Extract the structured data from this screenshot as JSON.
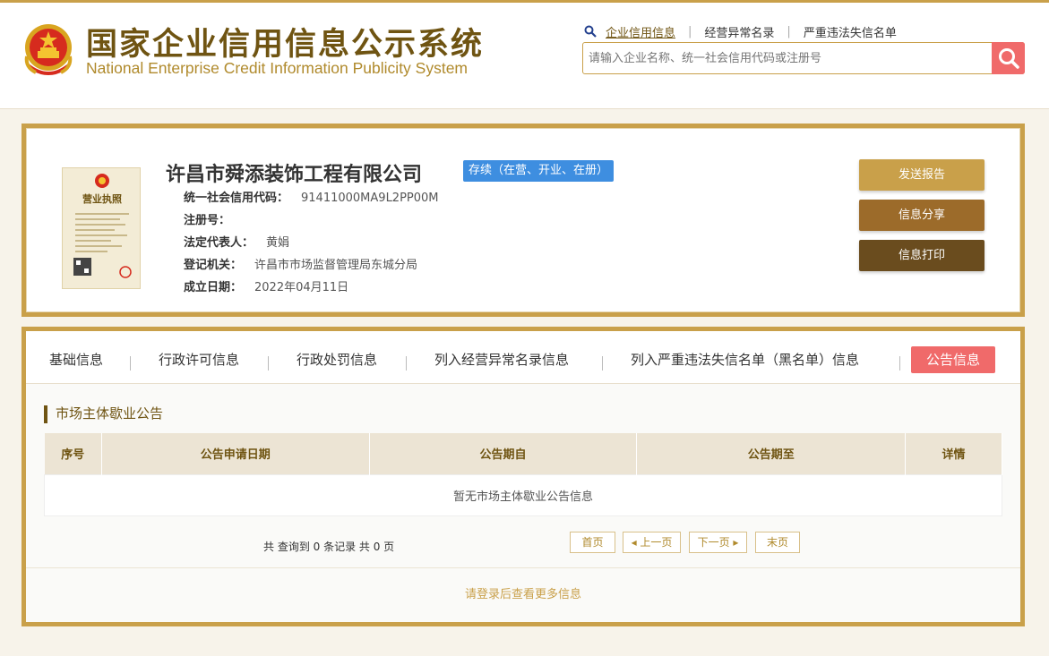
{
  "header": {
    "title_cn": "国家企业信用信息公示系统",
    "title_en": "National Enterprise Credit Information Publicity System",
    "nav": [
      "企业信用信息",
      "经营异常名录",
      "严重违法失信名单"
    ],
    "search_placeholder": "请输入企业名称、统一社会信用代码或注册号"
  },
  "company": {
    "name": "许昌市舜添装饰工程有限公司",
    "status": "存续（在营、开业、在册）",
    "fields": [
      {
        "label": "统一社会信用代码：",
        "value": "91411000MA9L2PP00M"
      },
      {
        "label": "注册号：",
        "value": ""
      },
      {
        "label": "法定代表人：",
        "value": "黄娟"
      },
      {
        "label": "登记机关：",
        "value": "许昌市市场监督管理局东城分局"
      },
      {
        "label": "成立日期：",
        "value": "2022年04月11日"
      }
    ],
    "license_title": "营业执照",
    "buttons": {
      "report": "发送报告",
      "share": "信息分享",
      "print": "信息打印"
    }
  },
  "tabs": [
    "基础信息",
    "行政许可信息",
    "行政处罚信息",
    "列入经营异常名录信息",
    "列入严重违法失信名单（黑名单）信息",
    "公告信息"
  ],
  "section": {
    "title": "市场主体歇业公告",
    "columns": [
      "序号",
      "公告申请日期",
      "公告期自",
      "公告期至",
      "详情"
    ],
    "empty_text": "暂无市场主体歇业公告信息"
  },
  "pager": {
    "info": "共 查询到 0 条记录 共 0 页",
    "first": "首页",
    "prev": "◂ 上一页",
    "next": "下一页 ▸",
    "last": "末页"
  },
  "login_tip": "请登录后查看更多信息",
  "colors": {
    "gold": "#c9a04a",
    "brown": "#6f5412",
    "red": "#f06a6a",
    "blue": "#3e8ee0"
  }
}
